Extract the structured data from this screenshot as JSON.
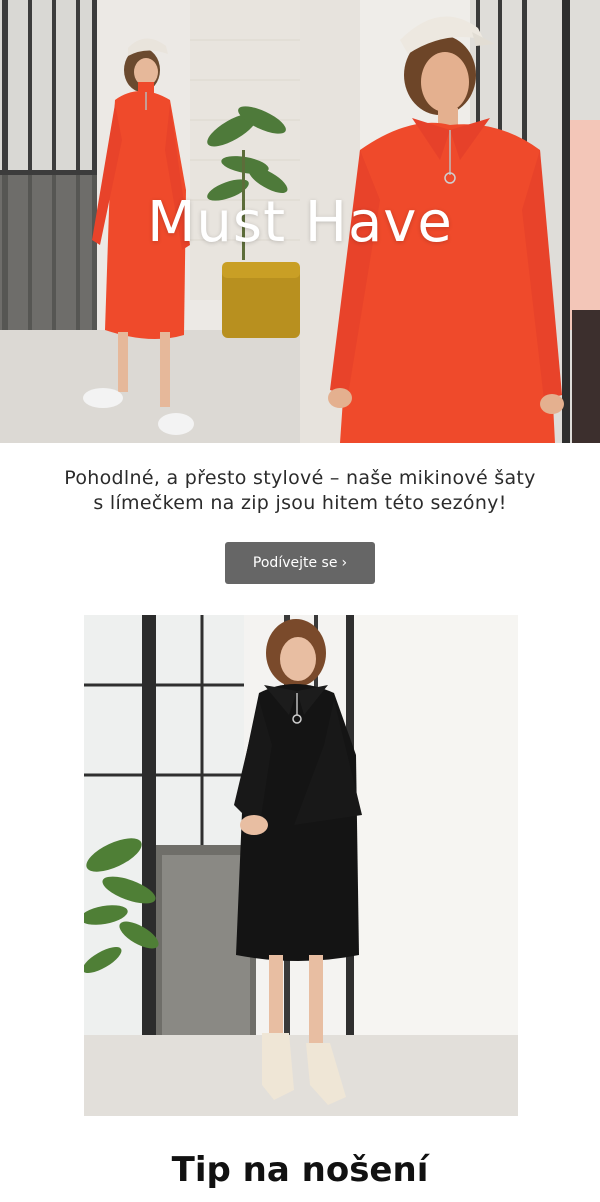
{
  "hero": {
    "title": "Must Have"
  },
  "intro": {
    "line1": "Pohodlné, a přesto stylové – naše mikinové šaty",
    "line2": "s límečkem na zip jsou hitem této sezóny!"
  },
  "cta": {
    "label": "Podívejte se",
    "icon": "chevron-right-icon"
  },
  "section": {
    "title": "Tip na nošení"
  },
  "colors": {
    "dress_orange": "#ef4a2b",
    "dress_black": "#141414",
    "button": "#666666",
    "wall": "#f1efec"
  }
}
